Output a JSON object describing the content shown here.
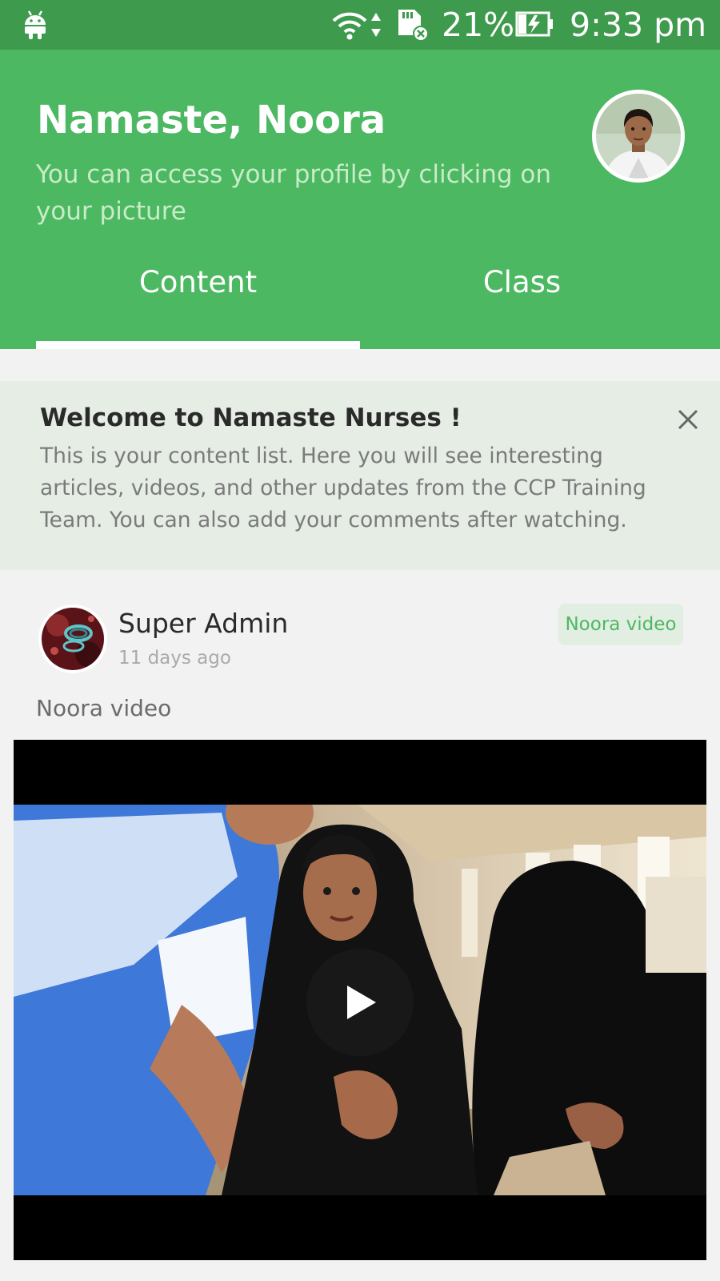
{
  "status_bar": {
    "battery_percent": "21%",
    "time": "9:33 pm",
    "icons": [
      "android-icon",
      "wifi-icon",
      "data-arrows-icon",
      "sd-card-icon",
      "battery-charging-icon"
    ]
  },
  "header": {
    "greeting": "Namaste, Noora",
    "subtitle": "You can access your profile by clicking on your picture",
    "background_color": "#4db862"
  },
  "tabs": [
    {
      "label": "Content",
      "selected": true
    },
    {
      "label": "Class",
      "selected": false
    }
  ],
  "welcome_card": {
    "title": "Welcome to Namaste Nurses !",
    "body": "This is your content list. Here you will see interesting articles, videos, and other updates from the CCP Training Team. You can also add your comments after watching.",
    "close_icon": "close-icon"
  },
  "post": {
    "author": "Super Admin",
    "time_ago": "11 days ago",
    "tag": "Noora video",
    "caption": "Noora video",
    "media_type": "video",
    "play_icon": "play-icon"
  },
  "colors": {
    "status_bar": "#3e9a4d",
    "accent": "#4db862",
    "welcome_bg": "#e5ede5",
    "page_bg": "#f2f2f2"
  }
}
